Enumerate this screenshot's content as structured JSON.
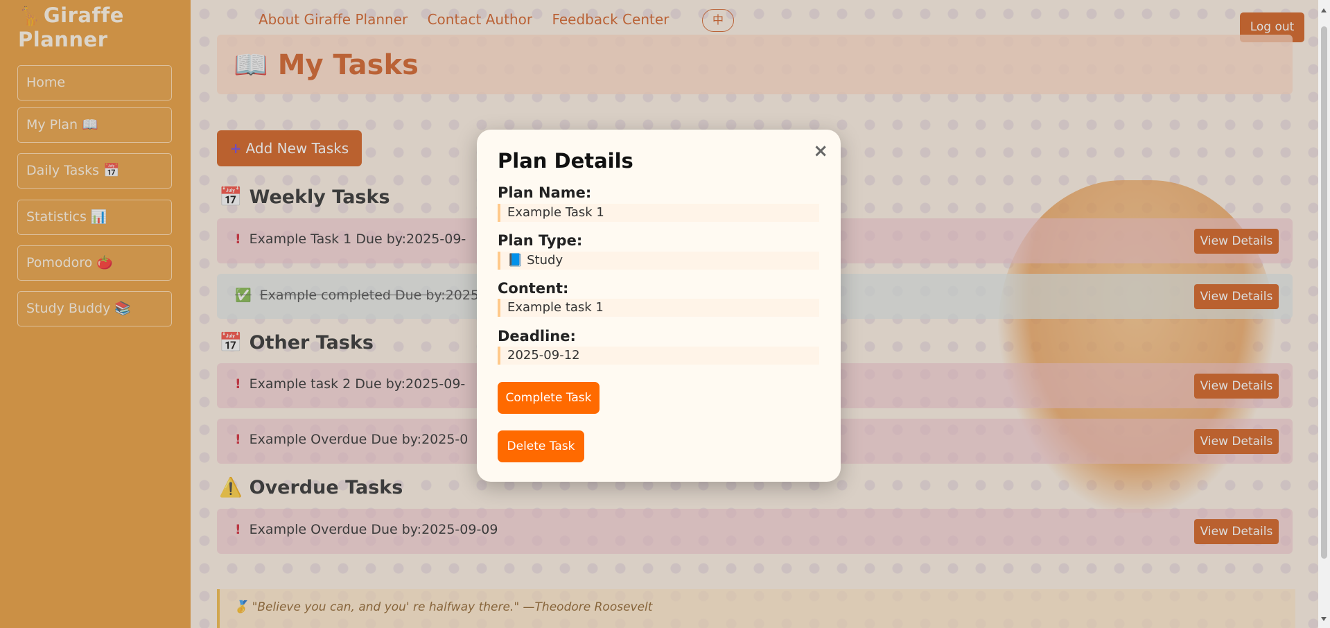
{
  "brand": {
    "icon": "🦒",
    "title": "Giraffe Planner"
  },
  "sidebar": {
    "items": [
      {
        "label": "Home"
      },
      {
        "label": "My Plan 📖"
      },
      {
        "label": "Daily Tasks 📅"
      },
      {
        "label": "Statistics 📊"
      },
      {
        "label": "Pomodoro 🍅"
      },
      {
        "label": "Study Buddy 📚"
      }
    ]
  },
  "topnav": {
    "about": "About Giraffe Planner",
    "contact": "Contact Author",
    "feedback": "Feedback Center",
    "lang": "中",
    "logout": "Log out"
  },
  "page": {
    "title_icon": "📖",
    "title": "My Tasks",
    "add_icon": "+",
    "add_label": "Add New Tasks"
  },
  "sections": {
    "weekly": {
      "icon": "📅",
      "title": "Weekly Tasks"
    },
    "other": {
      "icon": "📅",
      "title": "Other Tasks"
    },
    "overdue": {
      "icon": "⚠️",
      "title": "Overdue Tasks"
    }
  },
  "tasks": [
    {
      "mark": "!",
      "text": "Example Task 1 Due by:2025-09-",
      "button": "View Details"
    },
    {
      "mark": "✅",
      "text": "Example completed Due by:2025-",
      "button": "View Details"
    },
    {
      "mark": "!",
      "text": "Example task 2 Due by:2025-09-",
      "button": "View Details"
    },
    {
      "mark": "!",
      "text": "Example Overdue Due by:2025-0",
      "button": "View Details"
    },
    {
      "mark": "!",
      "text": "Example Overdue Due by:2025-09-09",
      "button": "View Details"
    }
  ],
  "quote": {
    "icon": "🥇",
    "text": "\"Believe you can, and you' re halfway there.\"  —Theodore Roosevelt"
  },
  "modal": {
    "title": "Plan Details",
    "close": "×",
    "name_label": "Plan Name:",
    "name_value": "Example Task 1",
    "type_label": "Plan Type:",
    "type_value": "📘 Study",
    "content_label": "Content:",
    "content_value": "Example task 1",
    "deadline_label": "Deadline:",
    "deadline_value": "2025-09-12",
    "complete_button": "Complete Task",
    "delete_button": "Delete Task"
  },
  "colors": {
    "sidebar": "#e8962e",
    "accent": "#d05510",
    "modal_button": "#ff6a00",
    "overdue_mark": "#d01a2a"
  }
}
